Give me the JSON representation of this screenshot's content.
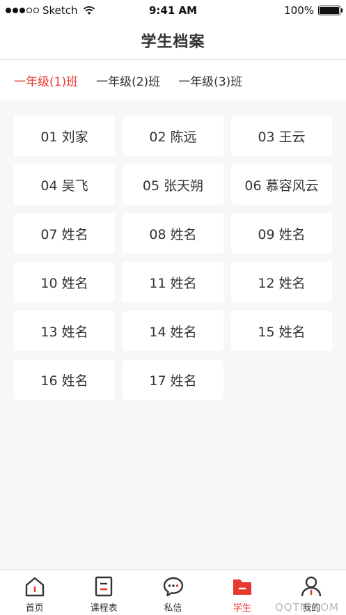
{
  "status": {
    "carrier": "Sketch",
    "time": "9:41 AM",
    "battery": "100%",
    "battery_level": 1.0,
    "signal_bars": 3
  },
  "header": {
    "title": "学生档案"
  },
  "classes": {
    "tabs": [
      {
        "label": "一年级(1)班",
        "active": true
      },
      {
        "label": "一年级(2)班",
        "active": false
      },
      {
        "label": "一年级(3)班",
        "active": false
      }
    ]
  },
  "students": [
    {
      "label": "01 刘家"
    },
    {
      "label": "02 陈远"
    },
    {
      "label": "03 王云"
    },
    {
      "label": "04 吴飞"
    },
    {
      "label": "05 张天朔"
    },
    {
      "label": "06 慕容风云"
    },
    {
      "label": "07 姓名"
    },
    {
      "label": "08 姓名"
    },
    {
      "label": "09 姓名"
    },
    {
      "label": "10 姓名"
    },
    {
      "label": "11 姓名"
    },
    {
      "label": "12 姓名"
    },
    {
      "label": "13 姓名"
    },
    {
      "label": "14 姓名"
    },
    {
      "label": "15 姓名"
    },
    {
      "label": "16 姓名"
    },
    {
      "label": "17 姓名"
    }
  ],
  "tabbar": {
    "items": [
      {
        "label": "首页",
        "icon": "home-icon",
        "active": false
      },
      {
        "label": "课程表",
        "icon": "schedule-icon",
        "active": false
      },
      {
        "label": "私信",
        "icon": "message-icon",
        "active": false
      },
      {
        "label": "学生",
        "icon": "folder-icon",
        "active": true
      },
      {
        "label": "我的",
        "icon": "profile-icon",
        "active": false
      }
    ]
  },
  "watermark": "QQTN.COM",
  "colors": {
    "accent": "#e8392f",
    "text": "#333333",
    "background": "#f7f7f7"
  }
}
